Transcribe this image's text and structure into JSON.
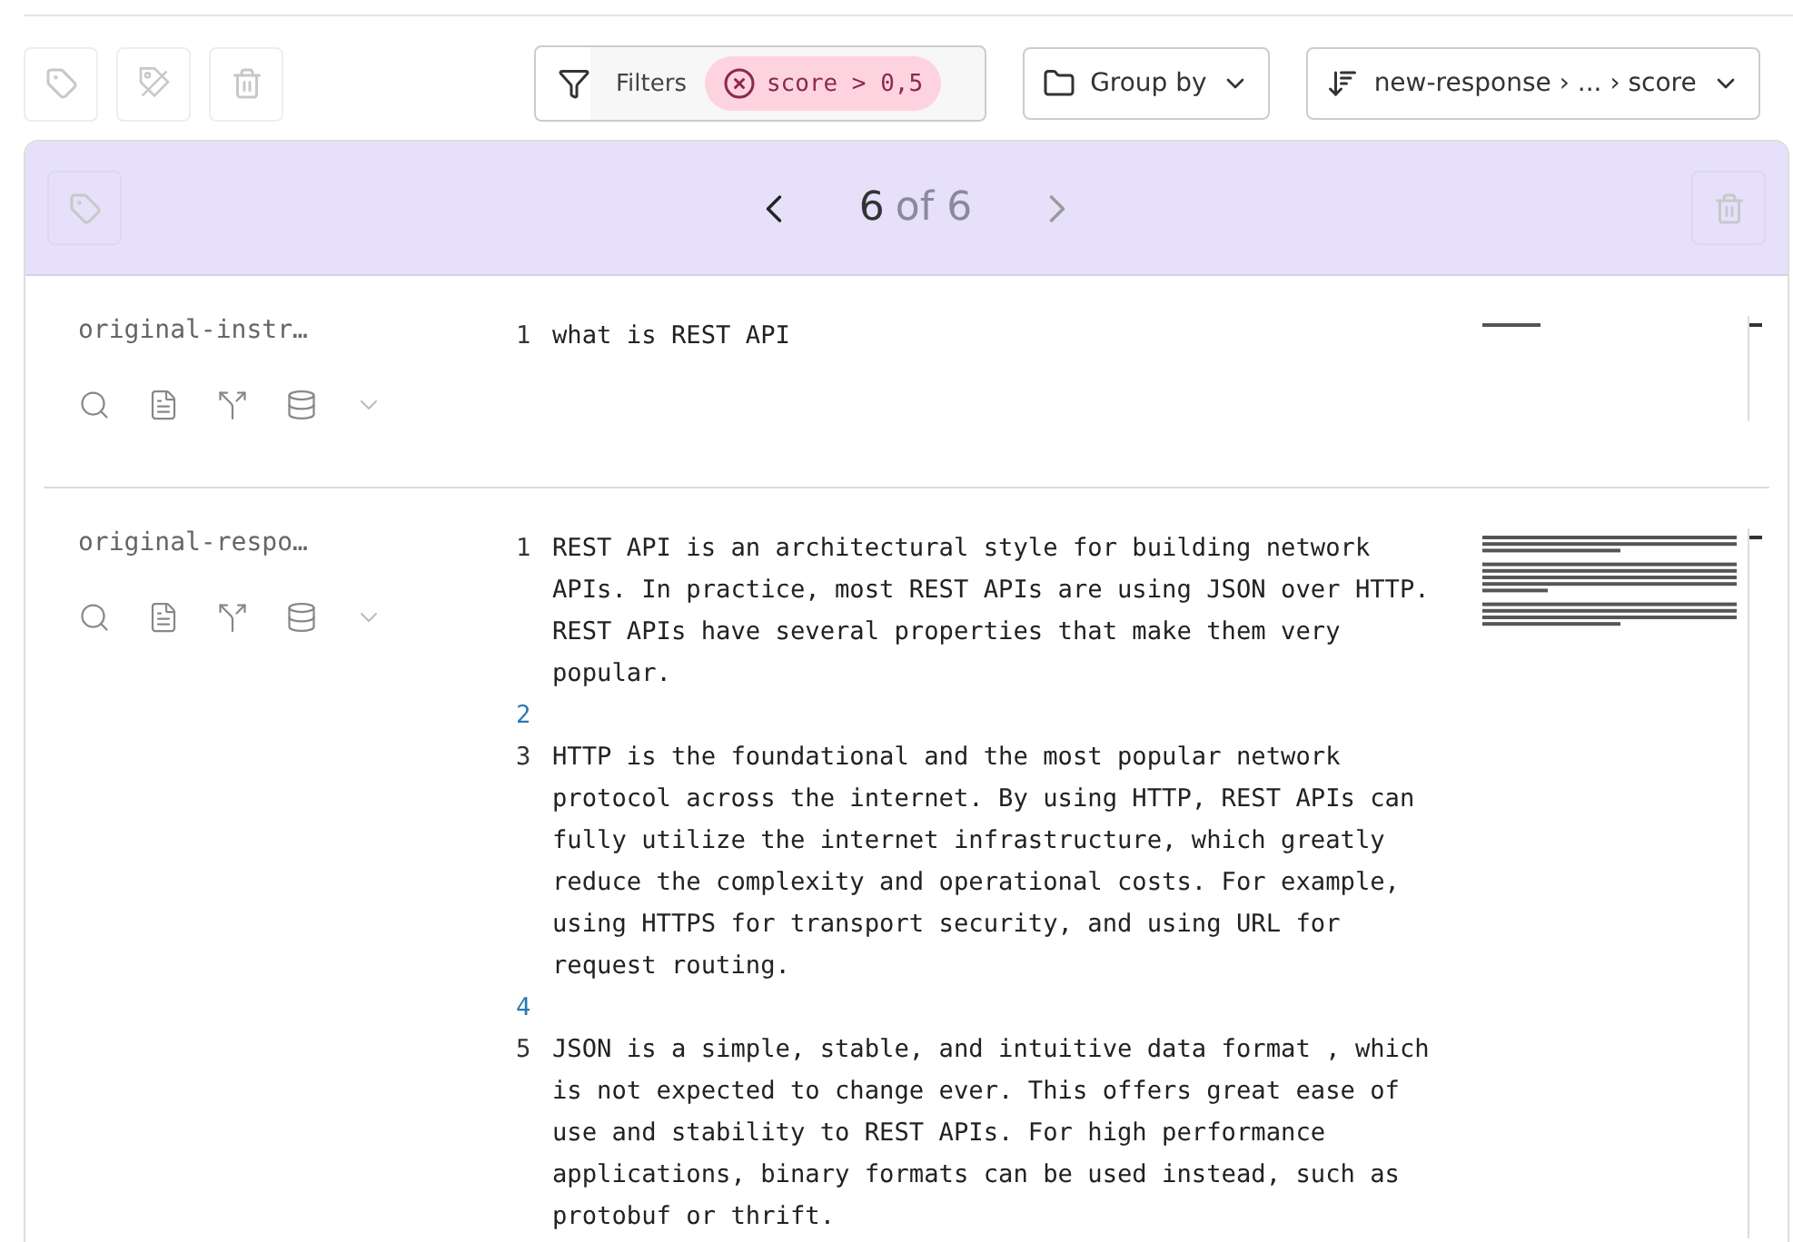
{
  "toolbar": {
    "actions": [
      {
        "kind": "tag",
        "disabled": true
      },
      {
        "kind": "untag",
        "disabled": true
      },
      {
        "kind": "delete",
        "disabled": true
      }
    ],
    "filters": {
      "label": "Filters",
      "chips": [
        {
          "text": "score > 0,5"
        }
      ]
    },
    "group_by": {
      "label": "Group by"
    },
    "sort": {
      "label": "new-response › ... › score"
    }
  },
  "pager": {
    "current": "6",
    "total": "of 6",
    "prev_disabled": false,
    "next_disabled": true,
    "tag_disabled": true,
    "delete_disabled": true
  },
  "fields": [
    {
      "name": "original-instr…",
      "lines": [
        {
          "number": "1",
          "text": "what is REST API"
        }
      ]
    },
    {
      "name": "original-respo…",
      "lines": [
        {
          "number": "1",
          "text": "REST API is an architectural style for building network APIs. In practice, most REST APIs are using JSON over HTTP. REST APIs have several properties that make them very popular."
        },
        {
          "number": "2"
        },
        {
          "number": "3",
          "text": "HTTP is the foundational and the most popular network protocol across the internet. By using HTTP, REST APIs can fully utilize the internet infrastructure, which greatly reduce the complexity and operational costs. For example, using HTTPS for transport security, and using URL for request routing."
        },
        {
          "number": "4"
        },
        {
          "number": "5",
          "text": "JSON is a simple, stable, and intuitive data format , which is not expected to change ever. This offers great ease of use and stability to REST APIs. For high performance applications, binary formats can be used instead, such as protobuf or thrift."
        }
      ]
    }
  ]
}
